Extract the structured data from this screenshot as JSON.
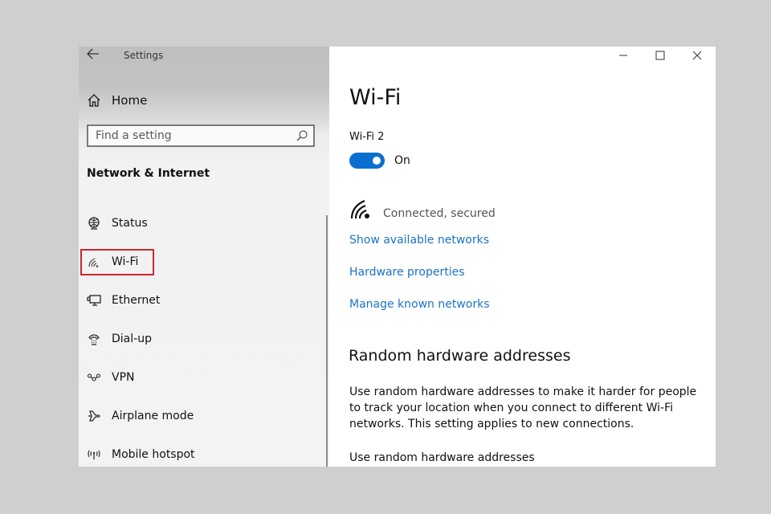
{
  "window": {
    "app_title": "Settings",
    "caption_buttons": {
      "minimize": "minimize-icon",
      "maximize": "maximize-icon",
      "close": "close-icon"
    }
  },
  "sidebar": {
    "back_icon": "arrow-left-icon",
    "home": {
      "label": "Home",
      "icon": "home-icon"
    },
    "search": {
      "placeholder": "Find a setting",
      "value": "",
      "icon": "search-icon"
    },
    "section_title": "Network & Internet",
    "items": [
      {
        "label": "Status",
        "icon": "globe-icon",
        "selected": false
      },
      {
        "label": "Wi-Fi",
        "icon": "wifi-icon",
        "selected": true
      },
      {
        "label": "Ethernet",
        "icon": "ethernet-icon",
        "selected": false
      },
      {
        "label": "Dial-up",
        "icon": "dialup-icon",
        "selected": false
      },
      {
        "label": "VPN",
        "icon": "vpn-icon",
        "selected": false
      },
      {
        "label": "Airplane mode",
        "icon": "airplane-icon",
        "selected": false
      },
      {
        "label": "Mobile hotspot",
        "icon": "hotspot-icon",
        "selected": false
      }
    ],
    "highlight_color": "#d0262f"
  },
  "main": {
    "title": "Wi-Fi",
    "adapter_name": "Wi-Fi 2",
    "toggle": {
      "state": "On",
      "on": true,
      "color": "#0a6ed1"
    },
    "connection": {
      "icon": "wifi-signal-icon",
      "status": "Connected, secured"
    },
    "links": [
      "Show available networks",
      "Hardware properties",
      "Manage known networks"
    ],
    "link_color": "#1a73c4",
    "random_hw": {
      "title": "Random hardware addresses",
      "description": "Use random hardware addresses to make it harder for people to track your location when you connect to different Wi-Fi networks. This setting applies to new connections.",
      "setting_label": "Use random hardware addresses"
    }
  }
}
